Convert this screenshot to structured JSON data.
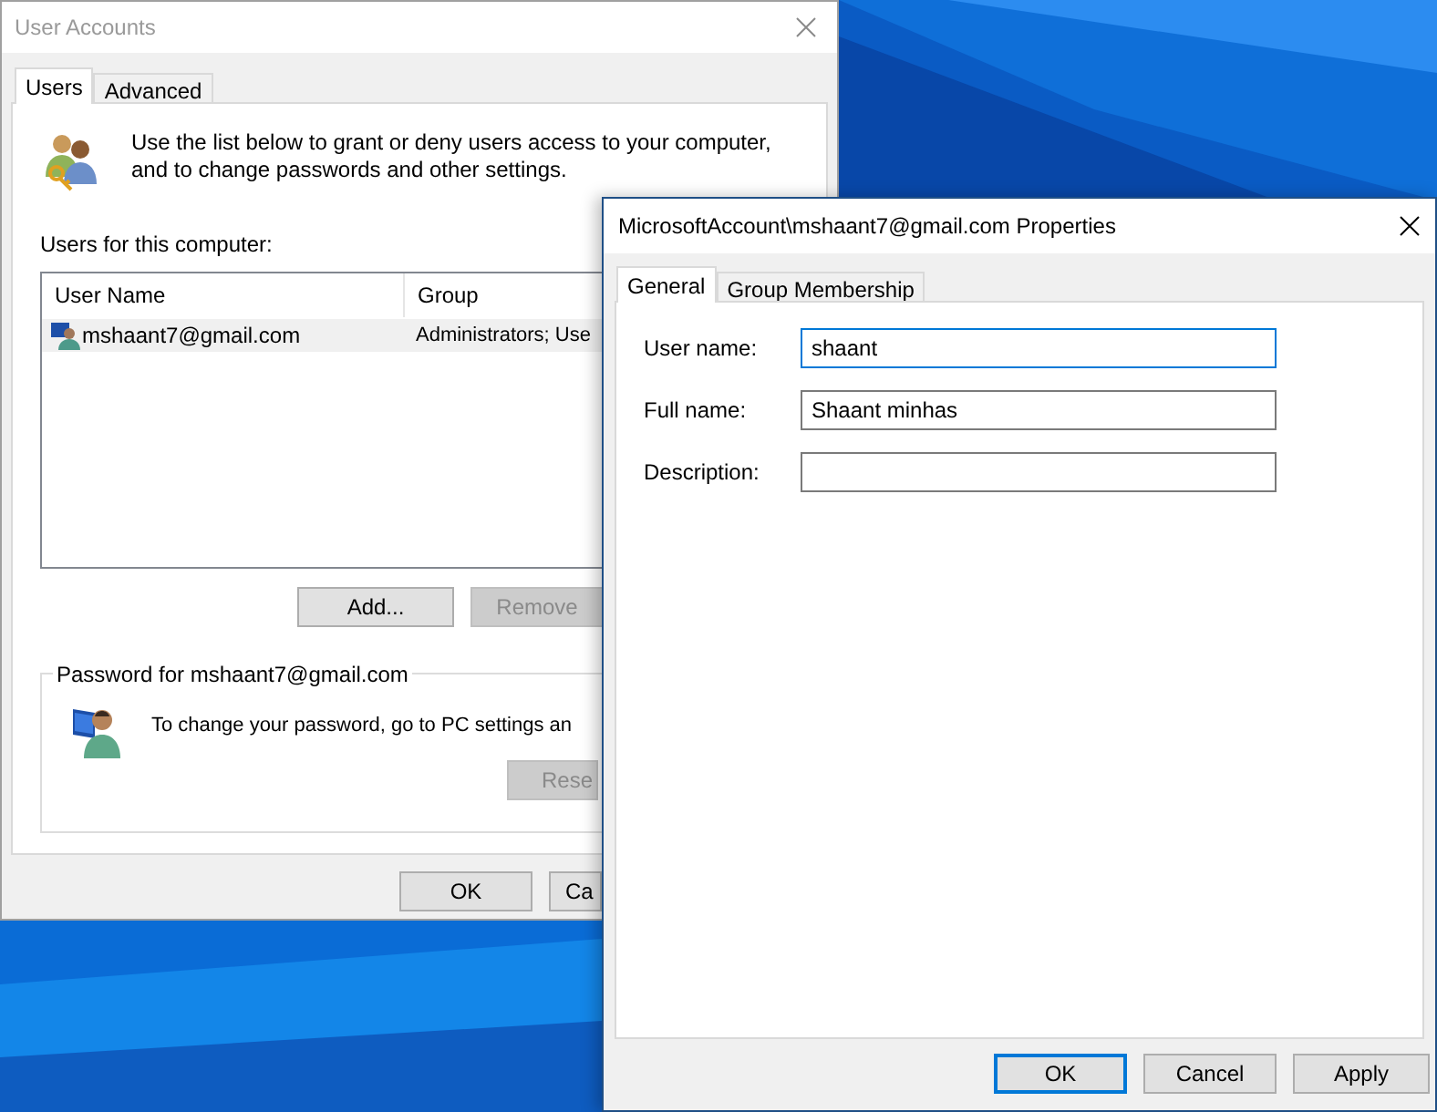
{
  "back_window": {
    "title": "User Accounts",
    "tabs": [
      {
        "label": "Users",
        "selected": true
      },
      {
        "label": "Advanced",
        "selected": false
      }
    ],
    "intro": "Use the list below to grant or deny users access to your computer, and to change passwords and other settings.",
    "list_label": "Users for this computer:",
    "columns": [
      "User Name",
      "Group"
    ],
    "rows": [
      {
        "user_name": "mshaant7@gmail.com",
        "group": "Administrators; Use",
        "selected": true
      }
    ],
    "buttons": [
      {
        "label": "Add...",
        "disabled": false
      },
      {
        "label": "Remove",
        "disabled": true
      }
    ],
    "password_group": {
      "legend": "Password for mshaant7@gmail.com",
      "text": "To change your password, go to PC settings an",
      "button": {
        "label": "Rese",
        "disabled": true
      }
    },
    "footer_buttons": [
      {
        "label": "OK"
      },
      {
        "label": "Ca"
      }
    ]
  },
  "front_window": {
    "title": "MicrosoftAccount\\mshaant7@gmail.com Properties",
    "tabs": [
      {
        "label": "General",
        "selected": true
      },
      {
        "label": "Group Membership",
        "selected": false
      }
    ],
    "fields": [
      {
        "label": "User name:",
        "value": "shaant",
        "focused": true
      },
      {
        "label": "Full name:",
        "value": "Shaant minhas",
        "focused": false
      },
      {
        "label": "Description:",
        "focused": false
      }
    ],
    "footer_buttons": [
      {
        "label": "OK",
        "default": true
      },
      {
        "label": "Cancel",
        "default": false
      },
      {
        "label": "Apply",
        "default": false
      }
    ]
  }
}
